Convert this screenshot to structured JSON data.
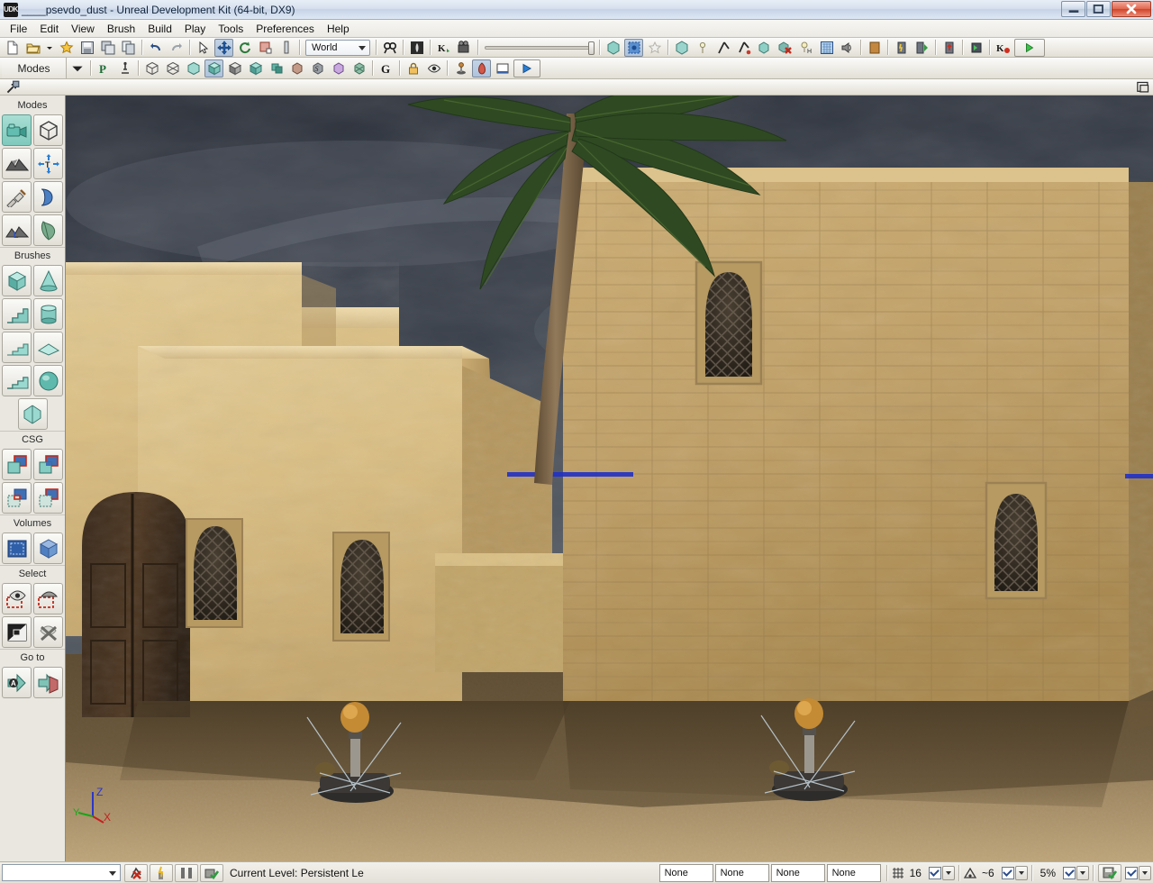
{
  "window": {
    "title": "____psevdo_dust - Unreal Development Kit (64-bit, DX9)",
    "app_icon": "udk-logo-icon",
    "minimize_label": "—",
    "maximize_label": "❐",
    "close_label": "✕"
  },
  "menu": {
    "items": [
      {
        "label": "File",
        "name": "menu-file"
      },
      {
        "label": "Edit",
        "name": "menu-edit"
      },
      {
        "label": "View",
        "name": "menu-view"
      },
      {
        "label": "Brush",
        "name": "menu-brush"
      },
      {
        "label": "Build",
        "name": "menu-build"
      },
      {
        "label": "Play",
        "name": "menu-play"
      },
      {
        "label": "Tools",
        "name": "menu-tools"
      },
      {
        "label": "Preferences",
        "name": "menu-preferences"
      },
      {
        "label": "Help",
        "name": "menu-help"
      }
    ]
  },
  "toolbar_main": {
    "coordinate_system": "World",
    "icons": [
      "new-file-icon",
      "open-file-icon",
      "open-dropdown-icon",
      "favorite-star-icon",
      "save-icon",
      "save-all-icon",
      "copy-icon",
      "undo-icon",
      "redo-icon",
      "select-cursor-icon",
      "translate-icon",
      "rotate-icon",
      "scale-icon",
      "scale-nonuniform-icon",
      "search-icon",
      "content-browser-icon",
      "kismet-icon",
      "matinee-icon",
      "camera-speed-slider",
      "volume-box-icon",
      "grid-snap-icon",
      "favorite-outline-icon",
      "lighting-icon",
      "light-point-icon",
      "path-build-icon",
      "path-rebuild-icon",
      "ai-paths-icon",
      "clear-paths-icon",
      "lightmass-icon",
      "terrain-icon",
      "sound-icon",
      "build-all-icon",
      "build-lighting-icon",
      "build-geometry-icon",
      "build-paths-icon",
      "build-cover-icon",
      "kismet-debug-icon",
      "play-in-editor-icon"
    ]
  },
  "toolbar_modes": {
    "modes_label": "Modes",
    "icons": [
      "modes-dropdown-icon",
      "prefab-p-icon",
      "actor-pin-icon",
      "wireframe-icon",
      "brush-wireframe-icon",
      "unlit-icon",
      "lit-icon",
      "lit-detail-icon",
      "lighting-only-icon",
      "light-complexity-icon",
      "texture-density-icon",
      "shader-complexity-icon",
      "lightmap-density-icon",
      "collision-icon",
      "game-view-g-icon",
      "lock-icon",
      "realtime-eye-icon",
      "actor-joystick-icon",
      "lighting-preview-icon",
      "viewport-maximize-icon",
      "play-viewport-icon",
      "undock-icon",
      "float-window-icon"
    ]
  },
  "sidebar": {
    "sections": [
      {
        "title": "Modes",
        "name": "sidebar-section-modes",
        "buttons": [
          {
            "name": "mode-camera-icon",
            "active": true
          },
          {
            "name": "mode-geometry-icon",
            "active": false
          },
          {
            "name": "mode-terrain-icon",
            "active": false
          },
          {
            "name": "mode-texture-icon",
            "active": false
          },
          {
            "name": "mode-mesh-paint-icon",
            "active": false
          },
          {
            "name": "mode-static-mesh-icon",
            "active": false
          },
          {
            "name": "mode-landscape-icon",
            "active": false
          },
          {
            "name": "mode-foliage-icon",
            "active": false
          }
        ]
      },
      {
        "title": "Brushes",
        "name": "sidebar-section-brushes",
        "buttons": [
          {
            "name": "brush-cube-icon",
            "active": false
          },
          {
            "name": "brush-cone-icon",
            "active": false
          },
          {
            "name": "brush-stairs-linear-icon",
            "active": false
          },
          {
            "name": "brush-cylinder-icon",
            "active": false
          },
          {
            "name": "brush-stairs-curved-icon",
            "active": false
          },
          {
            "name": "brush-sheet-icon",
            "active": false
          },
          {
            "name": "brush-spiral-stairs-icon",
            "active": false
          },
          {
            "name": "brush-sphere-icon",
            "active": false
          },
          {
            "name": "brush-tesselated-plane-icon",
            "active": false
          }
        ]
      },
      {
        "title": "CSG",
        "name": "sidebar-section-csg",
        "buttons": [
          {
            "name": "csg-add-icon",
            "active": false
          },
          {
            "name": "csg-subtract-icon",
            "active": false
          },
          {
            "name": "csg-intersect-icon",
            "active": false
          },
          {
            "name": "csg-deintersect-icon",
            "active": false
          }
        ]
      },
      {
        "title": "Volumes",
        "name": "sidebar-section-volumes",
        "buttons": [
          {
            "name": "volume-add-icon",
            "active": false
          },
          {
            "name": "volume-blocking-icon",
            "active": false
          }
        ]
      },
      {
        "title": "Select",
        "name": "sidebar-section-select",
        "buttons": [
          {
            "name": "select-show-icon",
            "active": false
          },
          {
            "name": "select-hide-icon",
            "active": false
          },
          {
            "name": "select-invert-icon",
            "active": false
          },
          {
            "name": "select-none-icon",
            "active": false
          }
        ]
      },
      {
        "title": "Go to",
        "name": "sidebar-section-goto",
        "buttons": [
          {
            "name": "goto-actor-icon",
            "active": false
          },
          {
            "name": "goto-brush-icon",
            "active": false
          }
        ]
      }
    ]
  },
  "viewport": {
    "name": "perspective-viewport",
    "gizmo": {
      "z_label": "Z",
      "x_label": "X",
      "y_label": "Y",
      "z_color": "#2a36c8",
      "x_color": "#c42020",
      "y_color": "#17a617"
    },
    "scene": {
      "description": "Desert town scene with sandstone buildings, arched grilled windows, wooden door, palm tree and stormy sky",
      "sky_top": "#2c323c",
      "sky_bottom": "#4d535c",
      "sand_color": "#c0a878",
      "wall_light": "#d9bf85",
      "wall_stone": "#c0a068",
      "selected_props": [
        "lamp-post-prop-left",
        "lamp-post-prop-right"
      ]
    }
  },
  "statusbar": {
    "level_combo_value": "",
    "icons": [
      "clear-paths-icon",
      "build-lighting-icon",
      "split-view-icon",
      "package-ok-icon"
    ],
    "current_level_label": "Current Level:  Persistent Le",
    "fields": [
      {
        "name": "status-field-drag-grid",
        "value": "None"
      },
      {
        "name": "status-field-rotation-grid",
        "value": "None"
      },
      {
        "name": "status-field-scale-grid",
        "value": "None"
      },
      {
        "name": "status-field-camera-speed",
        "value": "None"
      }
    ],
    "grid_snap": {
      "icon": "grid-icon",
      "value": "16",
      "checked": true
    },
    "angle_snap": {
      "icon": "angle-icon",
      "value": "~6",
      "checked": true
    },
    "scale_snap": {
      "value": "5%",
      "checked": true
    },
    "autosave": {
      "icon": "autosave-ok-icon",
      "checked": true
    }
  }
}
